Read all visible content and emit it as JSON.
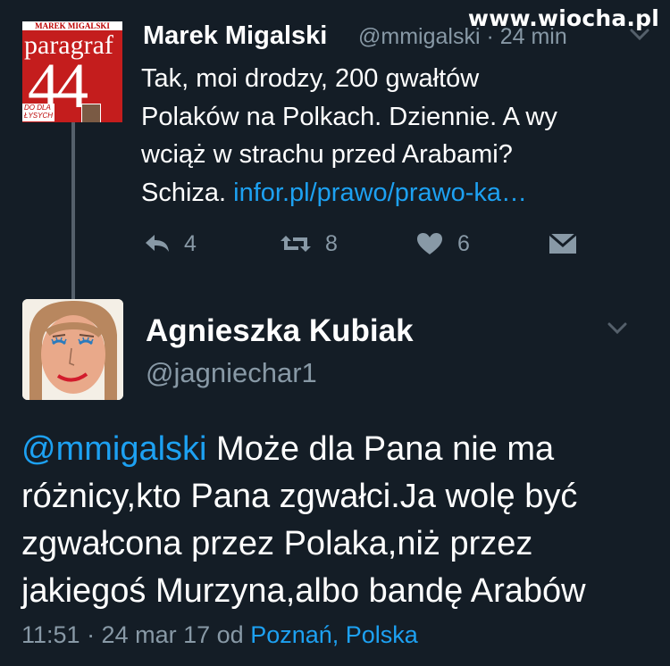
{
  "watermark": "www.wiocha.pl",
  "tweet1": {
    "avatar": {
      "top_text": "MAREK MIGALSKI",
      "word": "paragraf",
      "number": "44",
      "small_text": "DO DLA ŁYSYCH"
    },
    "author_name": "Marek Migalski",
    "handle_time": "@mmigalski · 24 min",
    "text_lines": [
      "Tak, moi drodzy, 200 gwałtów",
      "Polaków na Polkach. Dziennie. A wy",
      "wciąż w strachu przed Arabami?"
    ],
    "text_last": "Schiza.",
    "link": "infor.pl/prawo/prawo-ka…",
    "actions": {
      "reply_count": "4",
      "retweet_count": "8",
      "like_count": "6"
    },
    "icons": [
      "reply-icon",
      "retweet-icon",
      "like-icon",
      "message-icon",
      "chevron-down-icon"
    ]
  },
  "tweet2": {
    "author_name": "Agnieszka Kubiak",
    "handle": "@jagniechar1",
    "mention": "@mmigalski",
    "text_first": "Może dla Pana nie ma",
    "text_lines": [
      "różnicy,kto Pana zgwałci.Ja wolę być",
      "zgwałcona przez Polaka,niż przez",
      "jakiegoś Murzyna,albo bandę Arabów"
    ],
    "meta_time": "11:51 · 24 mar 17",
    "meta_from": "od",
    "meta_location": "Poznań, Polska"
  },
  "colors": {
    "background": "#141d26",
    "secondary_text": "#8899a6",
    "link": "#1da1f2",
    "thread_line": "#55606b"
  }
}
